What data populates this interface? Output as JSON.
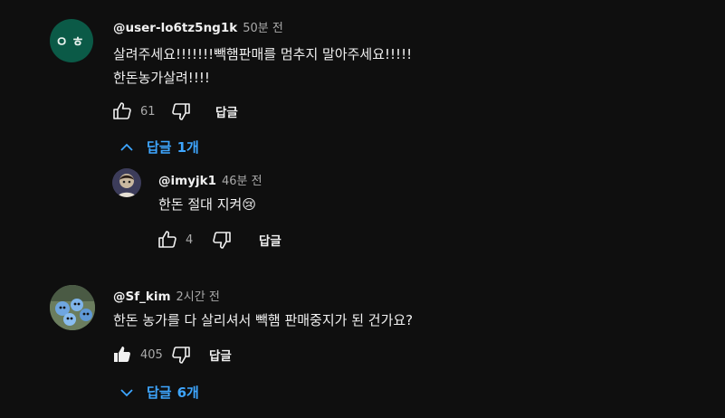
{
  "comments": [
    {
      "avatar_text": "ㅇㅎ",
      "author": "@user-lo6tz5ng1k",
      "time": "50분 전",
      "lines": [
        "살려주세요!!!!!!!빽햄판매를 멈추지 말아주세요!!!!!",
        "한돈농가살려!!!!"
      ],
      "likes": "61",
      "reply_label": "답글",
      "replies_toggle": {
        "label": "답글",
        "count": "1개",
        "state": "expanded"
      },
      "replies": [
        {
          "author": "@imyjk1",
          "time": "46분 전",
          "text": "한돈 절대 지켜😢",
          "likes": "4",
          "reply_label": "답글"
        }
      ]
    },
    {
      "author": "@Sf_kim",
      "time": "2시간 전",
      "lines": [
        "한돈 농가를 다 살리셔서 빽햄 판매중지가 된 건가요?"
      ],
      "likes": "405",
      "like_state": "liked",
      "reply_label": "답글",
      "replies_toggle": {
        "label": "답글",
        "count": "6개",
        "state": "collapsed"
      }
    }
  ],
  "colors": {
    "background": "#0f0f0f",
    "link": "#3ea6ff",
    "avatar1": "#0b5a47"
  }
}
